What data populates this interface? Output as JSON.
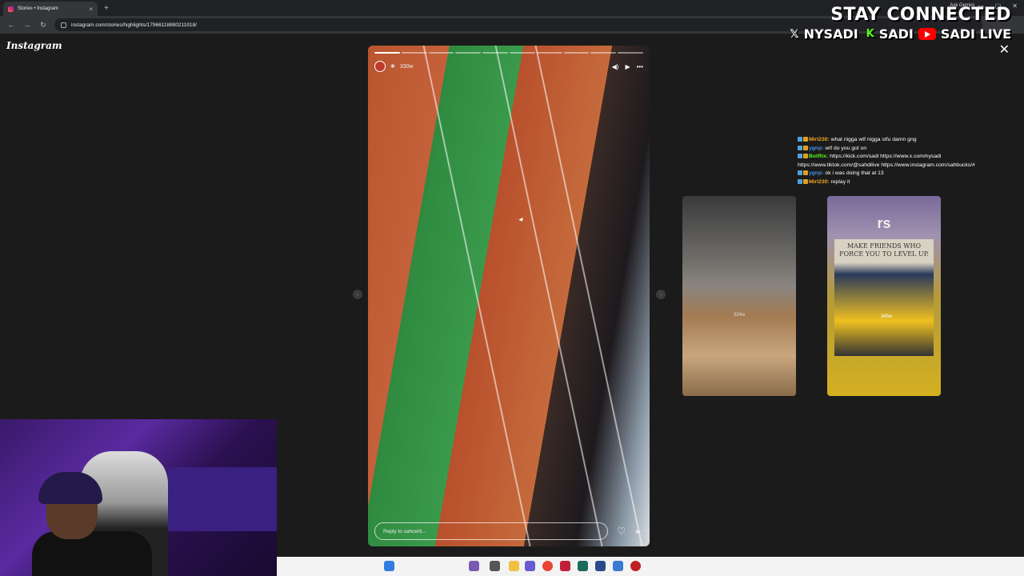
{
  "browser": {
    "tab_title": "Stories • Instagram",
    "new_tab": "+",
    "gemini": "Ask Gemini",
    "url": "instagram.com/stories/highlights/17966118880211918/"
  },
  "page": {
    "logo": "Instagram",
    "close": "✕"
  },
  "story": {
    "age": "330w",
    "segments": 10,
    "segments_done": 1,
    "reply_placeholder": "Reply to sahcerti..."
  },
  "side_stories": [
    {
      "age": "334w"
    },
    {
      "title": "rs",
      "caption": "MAKE FRIENDS WHO FORCE YOU TO LEVEL UP.",
      "age": "345w"
    }
  ],
  "chat": {
    "messages": [
      {
        "user": "Mirl230:",
        "color": "#f5a623",
        "text": "what nigga wtf nigga stfu damn gng"
      },
      {
        "user": "ygnp:",
        "color": "#4a90e2",
        "text": "wtf do you got on"
      },
      {
        "user": "BotRix:",
        "color": "#53fc18",
        "text": "https://kick.com/sadi https://www.x.com/nysadi https://www.tiktok.com/@sahdilive https://www.instagram.com/sahbucks/#"
      },
      {
        "user": "ygnp:",
        "color": "#4a90e2",
        "text": "ok i was doing that at 13"
      },
      {
        "user": "Mirl230:",
        "color": "#f5a623",
        "text": "replay it"
      }
    ]
  },
  "overlay": {
    "headline": "STAY CONNECTED",
    "x_handle": "NYSADI",
    "kick_handle": "SADI",
    "youtube_handle": "SADI LIVE"
  },
  "colors": {
    "accent_kick": "#53fc18",
    "accent_youtube": "#ff0000"
  }
}
